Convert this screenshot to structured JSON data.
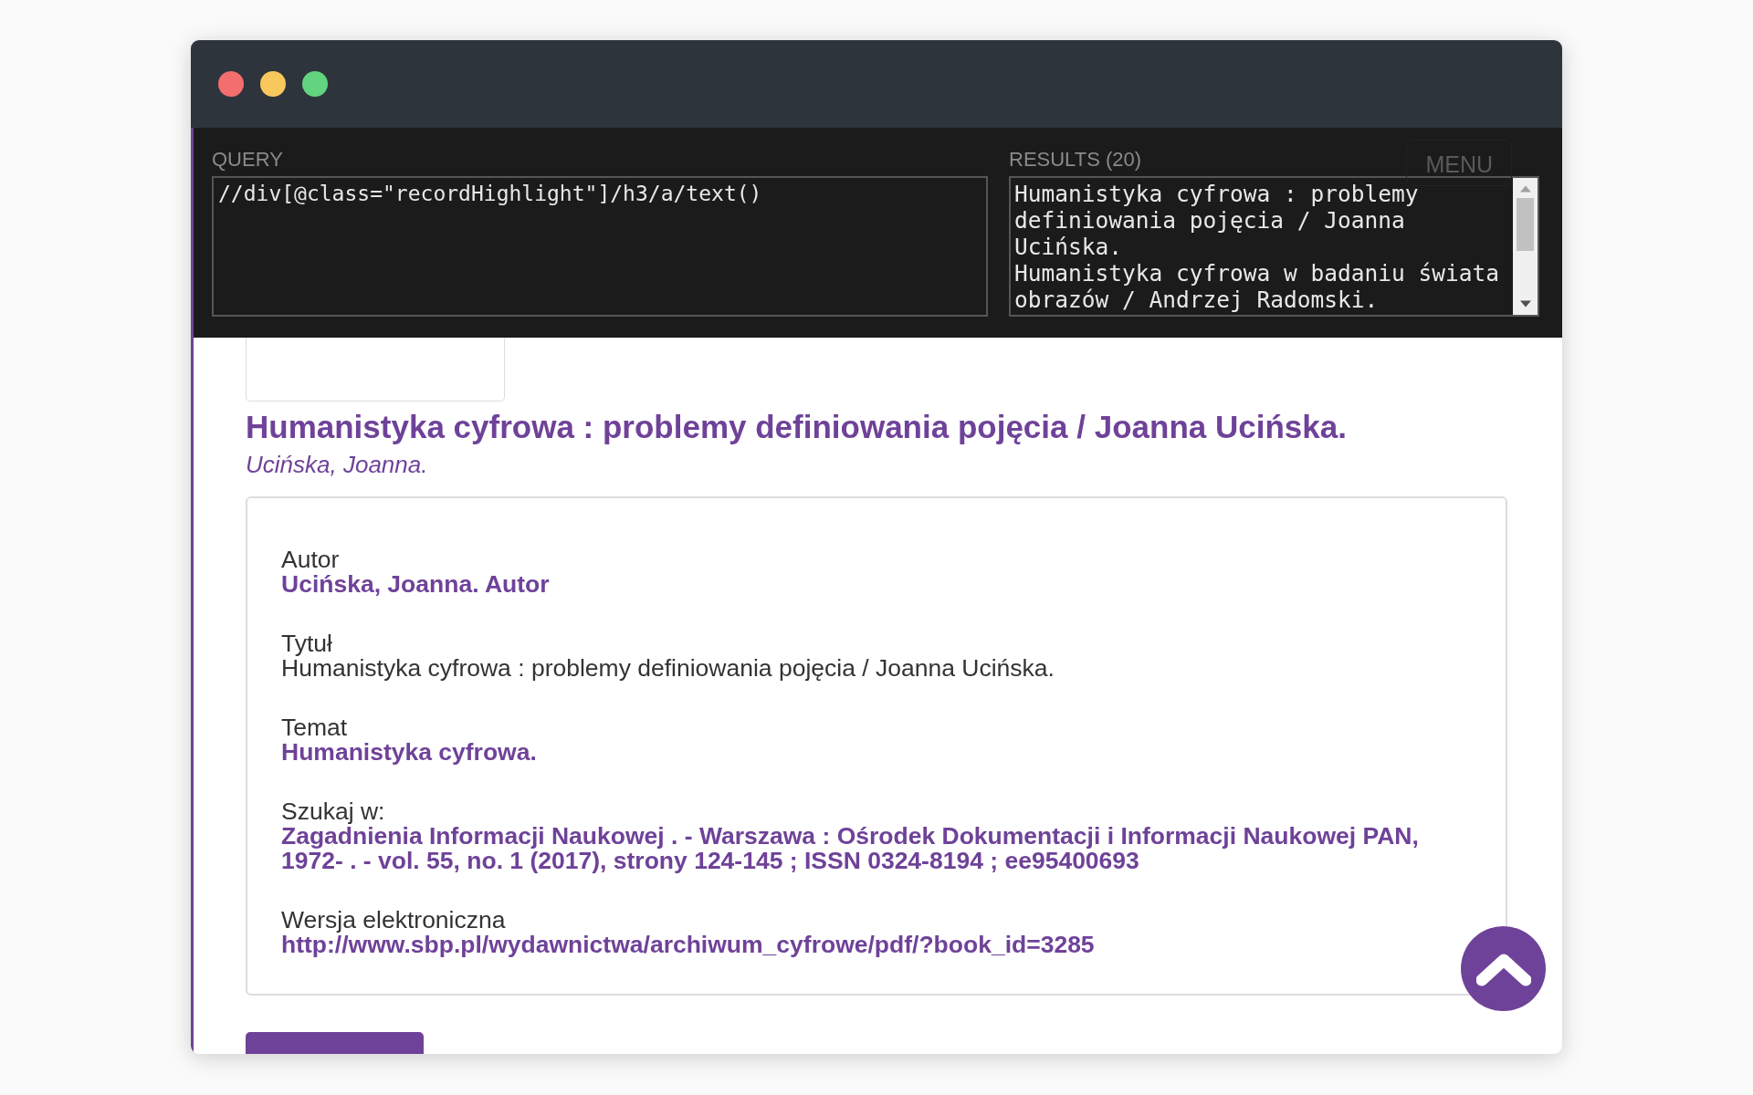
{
  "window": {
    "controls": [
      {
        "color": "#f36e6e"
      },
      {
        "color": "#f8c85c"
      },
      {
        "color": "#62d37f"
      }
    ]
  },
  "query": {
    "label": "QUERY",
    "value": "//div[@class=\"recordHighlight\"]/h3/a/text()"
  },
  "results": {
    "label": "RESULTS (20)",
    "items": [
      "Humanistyka cyfrowa : problemy definiowania pojęcia / Joanna Ucińska.",
      "Humanistyka cyfrowa w badaniu świata obrazów / Andrzej Radomski."
    ]
  },
  "menu": {
    "label": "MENU"
  },
  "record": {
    "title": "Humanistyka cyfrowa : problemy definiowania pojęcia / Joanna Ucińska.",
    "author": "Ucińska, Joanna.",
    "fields": [
      {
        "label": "Autor",
        "value": "Ucińska, Joanna. Autor",
        "kind": "link"
      },
      {
        "label": "Tytuł",
        "value": "Humanistyka cyfrowa : problemy definiowania pojęcia / Joanna Ucińska.",
        "kind": "text"
      },
      {
        "label": "Temat",
        "value": "Humanistyka cyfrowa.",
        "kind": "link"
      },
      {
        "label": "Szukaj w:",
        "value": "Zagadnienia Informacji Naukowej . - Warszawa : Ośrodek Dokumentacji i Informacji Naukowej PAN, 1972- . - vol. 55, no. 1 (2017), strony 124-145 ; ISSN 0324-8194 ; ee95400693",
        "kind": "link"
      },
      {
        "label": "Wersja elektroniczna",
        "value": "http://www.sbp.pl/wydawnictwa/archiwum_cyfrowe/pdf/?book_id=3285",
        "kind": "link"
      }
    ]
  }
}
